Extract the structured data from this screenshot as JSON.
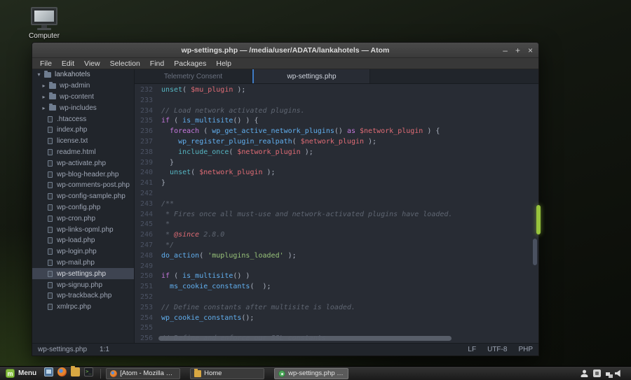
{
  "desktop": {
    "computer_label": "Computer"
  },
  "titlebar": {
    "title": "wp-settings.php — /media/user/ADATA/lankahotels — Atom",
    "minimize_glyph": "–",
    "maximize_glyph": "+",
    "close_glyph": "×"
  },
  "menubar": {
    "items": [
      "File",
      "Edit",
      "View",
      "Selection",
      "Find",
      "Packages",
      "Help"
    ]
  },
  "tabs": [
    {
      "label": "Telemetry Consent",
      "active": false
    },
    {
      "label": "wp-settings.php",
      "active": true
    }
  ],
  "tree": {
    "root": "lankahotels",
    "folders": [
      "wp-admin",
      "wp-content",
      "wp-includes"
    ],
    "files": [
      ".htaccess",
      "index.php",
      "license.txt",
      "readme.html",
      "wp-activate.php",
      "wp-blog-header.php",
      "wp-comments-post.php",
      "wp-config-sample.php",
      "wp-config.php",
      "wp-cron.php",
      "wp-links-opml.php",
      "wp-load.php",
      "wp-login.php",
      "wp-mail.php",
      "wp-settings.php",
      "wp-signup.php",
      "wp-trackback.php",
      "xmlrpc.php"
    ],
    "selected_file": "wp-settings.php"
  },
  "editor": {
    "lines": [
      {
        "n": 232,
        "toks": [
          [
            "b",
            "unset"
          ],
          [
            "t",
            "( "
          ],
          [
            "v",
            "$mu_plugin"
          ],
          [
            "t",
            " );"
          ]
        ]
      },
      {
        "n": 233,
        "toks": []
      },
      {
        "n": 234,
        "toks": [
          [
            "c",
            "// Load network activated plugins."
          ]
        ]
      },
      {
        "n": 235,
        "toks": [
          [
            "k",
            "if"
          ],
          [
            "t",
            " ( "
          ],
          [
            "f",
            "is_multisite"
          ],
          [
            "t",
            "() ) {"
          ]
        ]
      },
      {
        "n": 236,
        "toks": [
          [
            "t",
            "  "
          ],
          [
            "k",
            "foreach"
          ],
          [
            "t",
            " ( "
          ],
          [
            "f",
            "wp_get_active_network_plugins"
          ],
          [
            "t",
            "() "
          ],
          [
            "k",
            "as"
          ],
          [
            "t",
            " "
          ],
          [
            "v",
            "$network_plugin"
          ],
          [
            "t",
            " ) {"
          ]
        ]
      },
      {
        "n": 237,
        "toks": [
          [
            "t",
            "    "
          ],
          [
            "f",
            "wp_register_plugin_realpath"
          ],
          [
            "t",
            "( "
          ],
          [
            "v",
            "$network_plugin"
          ],
          [
            "t",
            " );"
          ]
        ]
      },
      {
        "n": 238,
        "toks": [
          [
            "t",
            "    "
          ],
          [
            "b",
            "include_once"
          ],
          [
            "t",
            "( "
          ],
          [
            "v",
            "$network_plugin"
          ],
          [
            "t",
            " );"
          ]
        ]
      },
      {
        "n": 239,
        "toks": [
          [
            "t",
            "  }"
          ]
        ]
      },
      {
        "n": 240,
        "toks": [
          [
            "t",
            "  "
          ],
          [
            "b",
            "unset"
          ],
          [
            "t",
            "( "
          ],
          [
            "v",
            "$network_plugin"
          ],
          [
            "t",
            " );"
          ]
        ]
      },
      {
        "n": 241,
        "toks": [
          [
            "t",
            "}"
          ]
        ]
      },
      {
        "n": 242,
        "toks": []
      },
      {
        "n": 243,
        "toks": [
          [
            "c",
            "/**"
          ]
        ]
      },
      {
        "n": 244,
        "toks": [
          [
            "c",
            " * Fires once all must-use and network-activated plugins have loaded."
          ]
        ]
      },
      {
        "n": 245,
        "toks": [
          [
            "c",
            " *"
          ]
        ]
      },
      {
        "n": 246,
        "toks": [
          [
            "c",
            " * "
          ],
          [
            "d",
            "@since"
          ],
          [
            "c",
            " 2.8.0"
          ]
        ]
      },
      {
        "n": 247,
        "toks": [
          [
            "c",
            " */"
          ]
        ]
      },
      {
        "n": 248,
        "toks": [
          [
            "f",
            "do_action"
          ],
          [
            "t",
            "( "
          ],
          [
            "s",
            "'muplugins_loaded'"
          ],
          [
            "t",
            " );"
          ]
        ]
      },
      {
        "n": 249,
        "toks": []
      },
      {
        "n": 250,
        "toks": [
          [
            "k",
            "if"
          ],
          [
            "t",
            " ( "
          ],
          [
            "f",
            "is_multisite"
          ],
          [
            "t",
            "() )"
          ]
        ]
      },
      {
        "n": 251,
        "toks": [
          [
            "t",
            "  "
          ],
          [
            "f",
            "ms_cookie_constants"
          ],
          [
            "t",
            "(  );"
          ]
        ]
      },
      {
        "n": 252,
        "toks": []
      },
      {
        "n": 253,
        "toks": [
          [
            "c",
            "// Define constants after multisite is loaded."
          ]
        ]
      },
      {
        "n": 254,
        "toks": [
          [
            "f",
            "wp_cookie_constants"
          ],
          [
            "t",
            "();"
          ]
        ]
      },
      {
        "n": 255,
        "toks": []
      },
      {
        "n": 256,
        "toks": [
          [
            "c",
            "// Define and enforce our SSL constants"
          ]
        ]
      }
    ]
  },
  "statusbar": {
    "file": "wp-settings.php",
    "cursor": "1:1",
    "line_ending": "LF",
    "encoding": "UTF-8",
    "grammar": "PHP"
  },
  "taskbar": {
    "menu": "Menu",
    "quick_launch": [
      "show-desktop",
      "firefox",
      "files",
      "terminal"
    ],
    "windows": [
      {
        "label": "[Atom - Mozilla Firef...",
        "icon": "firefox",
        "active": false
      },
      {
        "label": "Home",
        "icon": "folder",
        "active": false
      },
      {
        "label": "wp-settings.php — /...",
        "icon": "atom",
        "active": true
      }
    ],
    "tray_icons": [
      "user",
      "removable-drive",
      "network",
      "volume"
    ]
  },
  "colors": {
    "editor_bg": "#282c34",
    "panel_bg": "#21252b",
    "keyword_purple": "#c678dd",
    "function_blue": "#61afef",
    "builtin_cyan": "#56b6c2",
    "variable_red": "#e06c75",
    "string_green": "#98c379",
    "comment_gray": "#5f6672",
    "selection_bg": "#3e4451",
    "mint_green": "#87bf40",
    "accent_bar_green": "#97c43c"
  }
}
